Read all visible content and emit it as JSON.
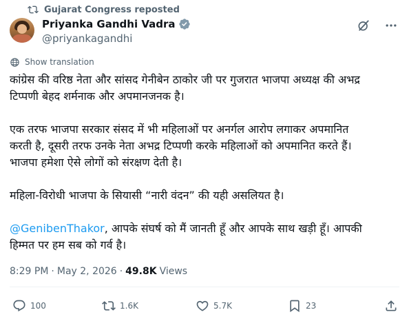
{
  "repost": {
    "label": "Gujarat Congress reposted"
  },
  "author": {
    "display_name": "Priyanka Gandhi Vadra",
    "handle": "@priyankagandhi"
  },
  "translation": {
    "label": "Show translation"
  },
  "tweet": {
    "p1_l1": "कांग्रेस की वरिष्ठ नेता और सांसद गेनीबेन ठाकोर जी पर गुजरात भाजपा अध्यक्ष की अभद्र",
    "p1_l2": "टिप्पणी बेहद शर्मनाक और अपमानजनक है।",
    "p2_l1": "एक तरफ भाजपा सरकार संसद में भी महिलाओं पर अनर्गल आरोप लगाकर अपमानित",
    "p2_l2": "करती है, दूसरी तरफ उनके नेता अभद्र टिप्पणी करके महिलाओं को अपमानित करते हैं।",
    "p2_l3": "भाजपा हमेशा ऐसे लोगों को संरक्षण देती है।",
    "p3_l1": "महिला-विरोधी भाजपा के सियासी “नारी वंदन” की यही असलियत है।",
    "p4_mention": "@GenibenThakor",
    "p4_l1_rest": ", आपके संघर्ष को मैं जानती हूँ और आपके साथ खड़ी हूँ। आपकी",
    "p4_l2": "हिम्मत पर हम सब को गर्व है।"
  },
  "meta": {
    "time": "8:29 PM",
    "separator": "·",
    "date": "May 2, 2026",
    "views_count": "49.8K",
    "views_label": "Views"
  },
  "actions": {
    "reply_count": "100",
    "repost_count": "1.6K",
    "like_count": "5.7K",
    "bookmark_count": "23"
  },
  "colors": {
    "text": "#0f1419",
    "secondary": "#536471",
    "link": "#1d9bf0",
    "verified": "#829aab"
  },
  "icons": [
    "repost-icon",
    "verified-badge-icon",
    "grok-icon",
    "more-icon",
    "translate-icon",
    "reply-icon",
    "like-icon",
    "bookmark-icon",
    "share-icon"
  ]
}
